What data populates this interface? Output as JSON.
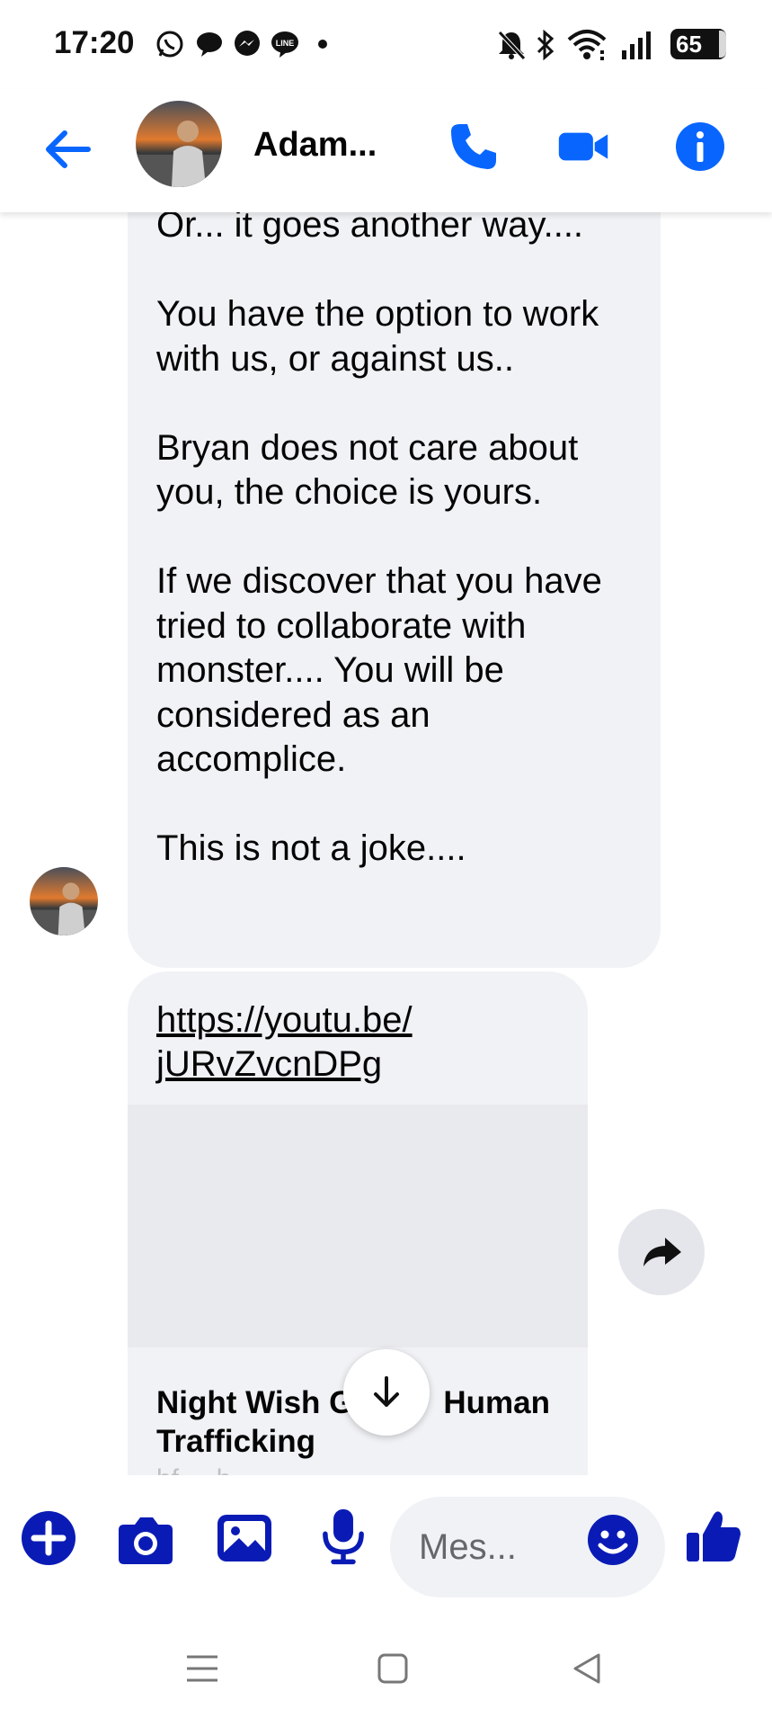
{
  "status_bar": {
    "time": "17:20",
    "left_icons": [
      "whatsapp-icon",
      "chat-bubble-icon",
      "messenger-icon",
      "line-icon",
      "dot-icon"
    ],
    "right_icons": [
      "bell-off-icon",
      "bluetooth-icon",
      "wifi-icon",
      "signal-icon"
    ],
    "battery": "65"
  },
  "header": {
    "contact_name": "Adam...",
    "buttons": [
      "back-arrow-icon",
      "phone-icon",
      "video-icon",
      "info-icon"
    ],
    "accent_color": "#0866ff"
  },
  "messages": {
    "text_block": "Or... it goes another way....\n\nYou have the option to work\nwith us, or against us..\n\nBryan does not care about\nyou, the choice is yours.\n\nIf we discover that you have\ntried to collaborate with\nmonster.... You will be\nconsidered as an\naccomplice.\n\nThis is not a joke....",
    "link_card": {
      "url": "https://youtu.be/\njURvZvcnDPg",
      "title_left": "Night Wish G",
      "title_right": "Human",
      "title_line2": "Trafficking",
      "subtitle": "bf  ...  b  ..."
    }
  },
  "composer": {
    "placeholder": "Mes...",
    "icons": [
      "plus-icon",
      "camera-icon",
      "image-icon",
      "microphone-icon",
      "emoji-icon",
      "thumbs-up-icon"
    ],
    "icon_color": "#0a1bb5"
  },
  "nav_bar": {
    "icons": [
      "menu-icon",
      "home-icon",
      "back-icon"
    ]
  },
  "bubble_color": "#f0f2f5"
}
